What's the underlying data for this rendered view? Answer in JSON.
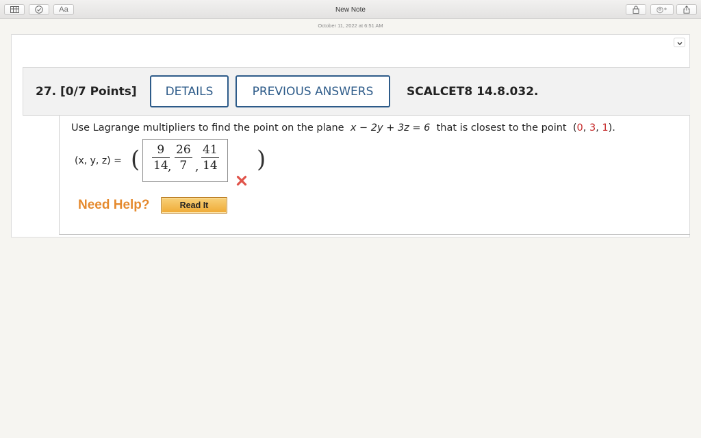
{
  "window": {
    "title": "New Note",
    "note_date": "October 11, 2022 at 6:51 AM",
    "format_button_label": "Aa"
  },
  "question": {
    "number_points": "27. [0/7 Points]",
    "details_label": "DETAILS",
    "previous_answers_label": "PREVIOUS ANSWERS",
    "code": "SCALCET8 14.8.032.",
    "prompt_start": "Use Lagrange multipliers to find the point on the plane",
    "equation": "x − 2y + 3z = 6",
    "prompt_mid": "that is closest to the point",
    "point_open": "(",
    "point_x": "0",
    "point_sep1": ", ",
    "point_y": "3",
    "point_sep2": ", ",
    "point_z": "1",
    "point_close": ").",
    "answer_label": "(x, y, z) =",
    "answer": {
      "frac1_num": "9",
      "frac1_den": "14",
      "frac2_num": "26",
      "frac2_den": "7",
      "frac3_num": "41",
      "frac3_den": "14",
      "separator": ","
    },
    "answer_status": "incorrect",
    "need_help_label": "Need Help?",
    "read_it_label": "Read It"
  },
  "icons": [
    "table-icon",
    "checklist-icon",
    "lock-icon",
    "collaborate-icon",
    "share-icon",
    "chevron-down-icon",
    "wrong-answer-x-icon"
  ],
  "colors": {
    "accent_blue": "#2d5b89",
    "point_red": "#c62828",
    "help_orange": "#e58a2e",
    "read_it_gold": "#efaa35",
    "wrong_red": "#e0534a"
  }
}
